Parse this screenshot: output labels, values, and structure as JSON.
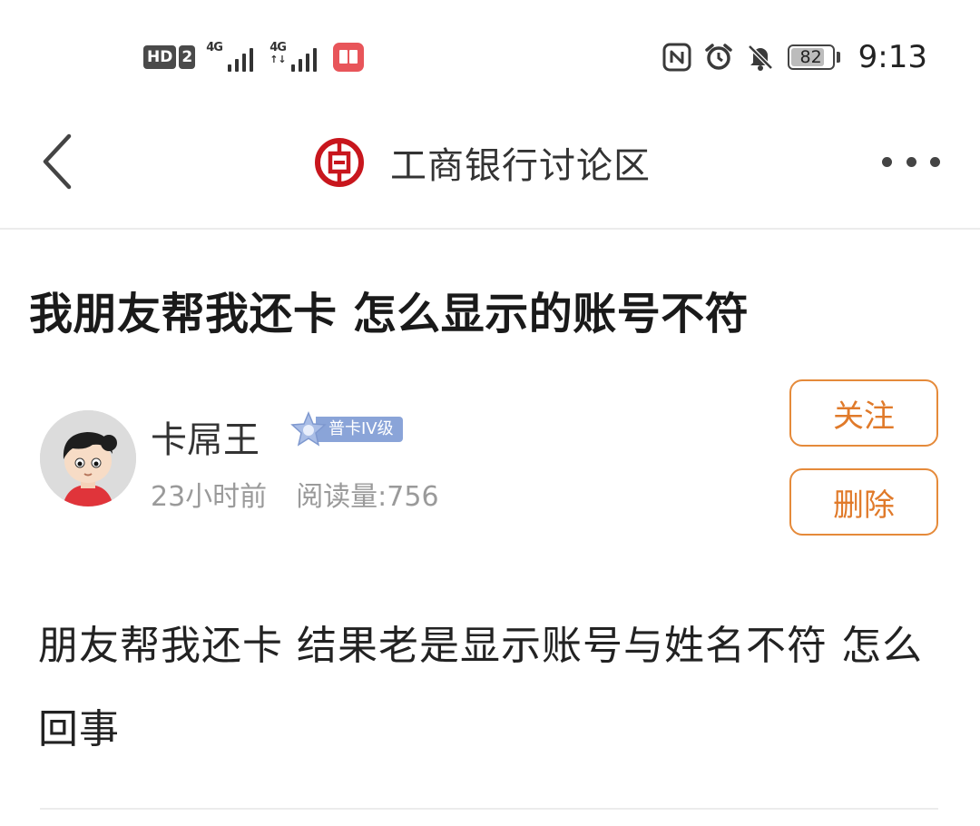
{
  "status_bar": {
    "hd_label": "HD",
    "sim_number": "2",
    "network_1": "4G",
    "network_2": "4G",
    "battery_level": "82",
    "battery_fraction": 0.82,
    "time": "9:13",
    "icons": [
      "nfc-icon",
      "alarm-icon",
      "mute-icon",
      "battery-icon"
    ]
  },
  "nav": {
    "title": "工商银行讨论区",
    "back_icon": "chevron-left-icon",
    "more_icon": "more-dots-icon",
    "logo_icon": "icbc-logo-icon",
    "accent": "#c8161d"
  },
  "post": {
    "title": "我朋友帮我还卡 怎么显示的账号不符",
    "author": {
      "name": "卡屌王",
      "level": "普卡IV级",
      "time_ago": "23小时前",
      "views": "阅读量:756"
    },
    "follow_label": "关注",
    "delete_label": "删除",
    "body": "朋友帮我还卡 结果老是显示账号与姓名不符 怎么回事",
    "button_color": "#e07a2a"
  }
}
